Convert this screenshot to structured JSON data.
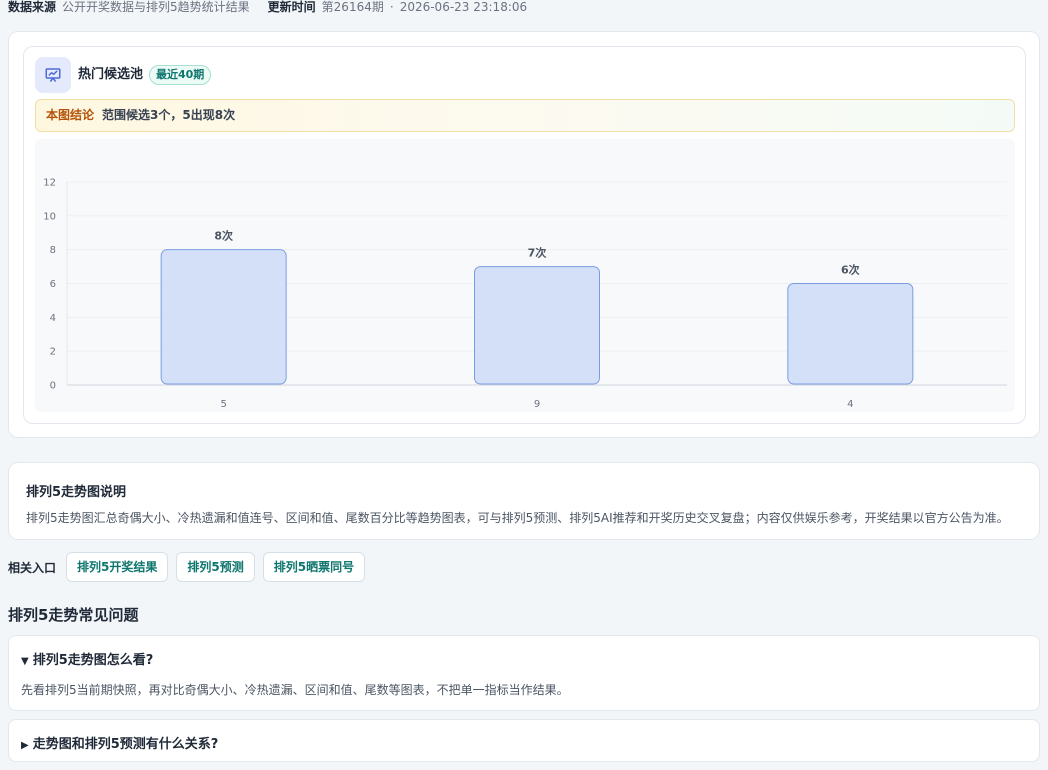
{
  "meta": {
    "source_label": "数据来源",
    "source_value": "公开开奖数据与排列5趋势统计结果",
    "update_label": "更新时间",
    "issue": "第26164期",
    "separator": "·",
    "timestamp": "2026-06-23 23:18:06"
  },
  "pool_card": {
    "icon": "presentation-chart-icon",
    "title": "热门候选池",
    "badge": "最近40期",
    "conclusion_label": "本图结论",
    "conclusion_text": "范围候选3个，5出现8次"
  },
  "colors": {
    "accent": "#0f766e",
    "bar_fill": "#d3e0f8",
    "bar_stroke": "#7b9ce3",
    "conclusion_label": "#b45309"
  },
  "chart_data": {
    "type": "bar",
    "categories": [
      "5",
      "9",
      "4"
    ],
    "values": [
      8,
      7,
      6
    ],
    "data_labels": [
      "8次",
      "7次",
      "6次"
    ],
    "ylim": [
      0,
      12
    ],
    "yticks": [
      "0",
      "2",
      "4",
      "6",
      "8",
      "10",
      "12"
    ],
    "grid": true
  },
  "description": {
    "title": "排列5走势图说明",
    "text": "排列5走势图汇总奇偶大小、冷热遗漏和值连号、区间和值、尾数百分比等趋势图表，可与排列5预测、排列5AI推荐和开奖历史交叉复盘；内容仅供娱乐参考，开奖结果以官方公告为准。"
  },
  "related": {
    "label": "相关入口",
    "links": [
      "排列5开奖结果",
      "排列5预测",
      "排列5晒票同号"
    ]
  },
  "faq": {
    "heading": "排列5走势常见问题",
    "items": [
      {
        "marker": "▼",
        "question": "排列5走势图怎么看?",
        "answer": "先看排列5当前期快照，再对比奇偶大小、冷热遗漏、区间和值、尾数等图表，不把单一指标当作结果。"
      },
      {
        "marker": "▶",
        "question": "走势图和排列5预测有什么关系?"
      }
    ]
  }
}
